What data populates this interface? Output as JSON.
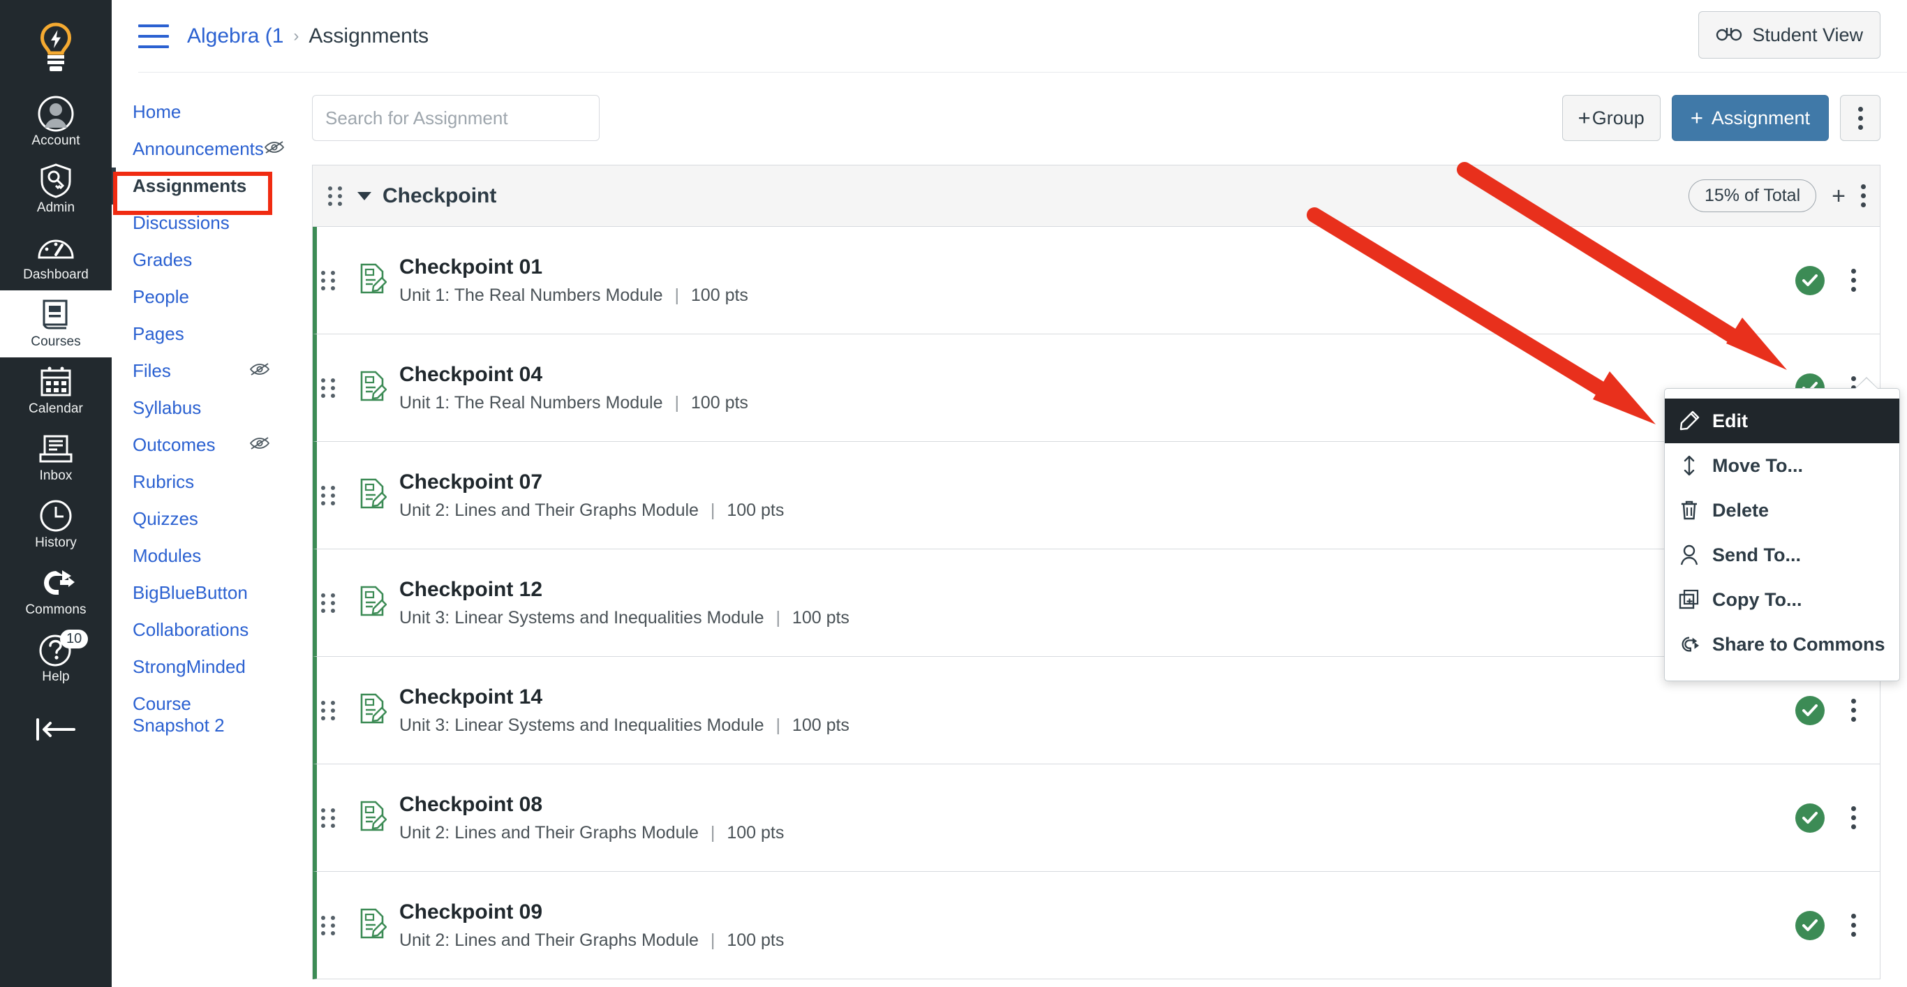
{
  "global_nav": {
    "logo_name": "canvas-logo",
    "items": [
      {
        "label": "Account",
        "icon": "account-avatar-icon",
        "active": false
      },
      {
        "label": "Admin",
        "icon": "shield-key-icon",
        "active": false
      },
      {
        "label": "Dashboard",
        "icon": "dashboard-gauge-icon",
        "active": false
      },
      {
        "label": "Courses",
        "icon": "book-icon",
        "active": true
      },
      {
        "label": "Calendar",
        "icon": "calendar-icon",
        "active": false
      },
      {
        "label": "Inbox",
        "icon": "inbox-tray-icon",
        "active": false
      },
      {
        "label": "History",
        "icon": "clock-icon",
        "active": false
      },
      {
        "label": "Commons",
        "icon": "commons-arrow-icon",
        "active": false
      },
      {
        "label": "Help",
        "icon": "question-circle-icon",
        "active": false,
        "badge": "10"
      }
    ],
    "collapse_label": "collapse-nav-arrow-icon"
  },
  "header": {
    "menu_icon": "hamburger-menu-icon",
    "breadcrumb_course": "Algebra (1",
    "breadcrumb_separator": "›",
    "breadcrumb_current": "Assignments",
    "student_view_label": "Student View",
    "student_view_icon": "glasses-icon"
  },
  "course_nav": {
    "items": [
      {
        "label": "Home",
        "hidden": false,
        "active": false
      },
      {
        "label": "Announcements",
        "hidden": true,
        "active": false
      },
      {
        "label": "Assignments",
        "hidden": false,
        "active": true
      },
      {
        "label": "Discussions",
        "hidden": false,
        "active": false
      },
      {
        "label": "Grades",
        "hidden": false,
        "active": false
      },
      {
        "label": "People",
        "hidden": false,
        "active": false
      },
      {
        "label": "Pages",
        "hidden": false,
        "active": false
      },
      {
        "label": "Files",
        "hidden": true,
        "active": false
      },
      {
        "label": "Syllabus",
        "hidden": false,
        "active": false
      },
      {
        "label": "Outcomes",
        "hidden": true,
        "active": false
      },
      {
        "label": "Rubrics",
        "hidden": false,
        "active": false
      },
      {
        "label": "Quizzes",
        "hidden": false,
        "active": false
      },
      {
        "label": "Modules",
        "hidden": false,
        "active": false
      },
      {
        "label": "BigBlueButton",
        "hidden": false,
        "active": false
      },
      {
        "label": "Collaborations",
        "hidden": false,
        "active": false
      },
      {
        "label": "StrongMinded",
        "hidden": false,
        "active": false
      },
      {
        "label": "Course Snapshot 2",
        "hidden": false,
        "active": false
      }
    ]
  },
  "toolbar": {
    "search_placeholder": "Search for Assignment",
    "search_value": "",
    "group_label": "Group",
    "assignment_label": "Assignment",
    "plus_glyph": "+",
    "more_icon": "kebab-menu-icon"
  },
  "assignment_group": {
    "title": "Checkpoint",
    "weight_label": "15% of Total",
    "add_icon": "plus-icon",
    "more_icon": "kebab-menu-icon",
    "collapse_icon": "caret-down-icon",
    "drag_icon": "drag-handle-icon"
  },
  "assignments": [
    {
      "title": "Checkpoint 01",
      "module": "Unit 1: The Real Numbers Module",
      "points": "100 pts",
      "published": true
    },
    {
      "title": "Checkpoint 04",
      "module": "Unit 1: The Real Numbers Module",
      "points": "100 pts",
      "published": true
    },
    {
      "title": "Checkpoint 07",
      "module": "Unit 2: Lines and Their Graphs Module",
      "points": "100 pts",
      "published": true
    },
    {
      "title": "Checkpoint 12",
      "module": "Unit 3: Linear Systems and Inequalities Module",
      "points": "100 pts",
      "published": true
    },
    {
      "title": "Checkpoint 14",
      "module": "Unit 3: Linear Systems and Inequalities Module",
      "points": "100 pts",
      "published": true
    },
    {
      "title": "Checkpoint 08",
      "module": "Unit 2: Lines and Their Graphs Module",
      "points": "100 pts",
      "published": true
    },
    {
      "title": "Checkpoint 09",
      "module": "Unit 2: Lines and Their Graphs Module",
      "points": "100 pts",
      "published": true
    }
  ],
  "context_menu": {
    "items": [
      {
        "label": "Edit",
        "icon": "pencil-icon",
        "highlighted": true
      },
      {
        "label": "Move To...",
        "icon": "move-updown-icon",
        "highlighted": false
      },
      {
        "label": "Delete",
        "icon": "trash-icon",
        "highlighted": false
      },
      {
        "label": "Send To...",
        "icon": "user-icon",
        "highlighted": false
      },
      {
        "label": "Copy To...",
        "icon": "copy-plus-icon",
        "highlighted": false
      },
      {
        "label": "Share to Commons",
        "icon": "commons-arrow-icon",
        "highlighted": false
      }
    ]
  },
  "annotations": {
    "arrow_color": "#E8301C",
    "arrows": [
      {
        "name": "arrow-to-row-kebab"
      },
      {
        "name": "arrow-to-edit-menu-item"
      }
    ],
    "highlight_box": {
      "name": "assignments-nav-highlight",
      "color": "#F02B11"
    }
  }
}
